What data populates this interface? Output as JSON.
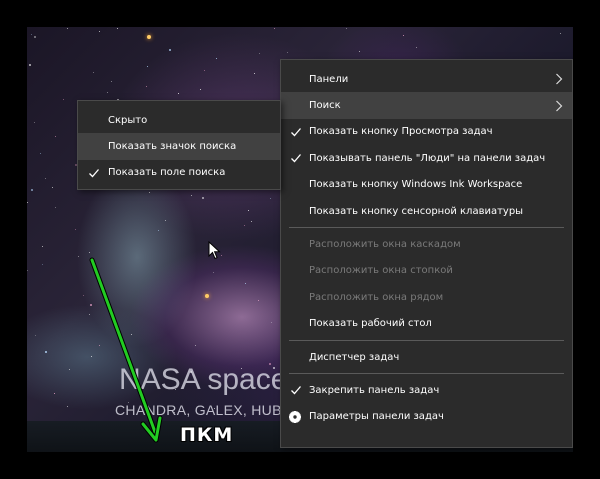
{
  "wallpaper": {
    "title": "NASA space",
    "subtitle": "CHANDRA, GALEX, HUB"
  },
  "annotation": {
    "label": "ПКМ",
    "arrow_color": "#22cc22"
  },
  "context_menu": {
    "groups": [
      [
        {
          "label": "Панели",
          "submenu": true,
          "checked": false,
          "disabled": false,
          "highlighted": false
        },
        {
          "label": "Поиск",
          "submenu": true,
          "checked": false,
          "disabled": false,
          "highlighted": true
        },
        {
          "label": "Показать кнопку Просмотра задач",
          "submenu": false,
          "checked": true,
          "disabled": false,
          "highlighted": false
        },
        {
          "label": "Показывать панель \"Люди\" на панели задач",
          "submenu": false,
          "checked": true,
          "disabled": false,
          "highlighted": false
        },
        {
          "label": "Показать кнопку Windows Ink Workspace",
          "submenu": false,
          "checked": false,
          "disabled": false,
          "highlighted": false
        },
        {
          "label": "Показать кнопку сенсорной клавиатуры",
          "submenu": false,
          "checked": false,
          "disabled": false,
          "highlighted": false
        }
      ],
      [
        {
          "label": "Расположить окна каскадом",
          "submenu": false,
          "checked": false,
          "disabled": true,
          "highlighted": false
        },
        {
          "label": "Расположить окна стопкой",
          "submenu": false,
          "checked": false,
          "disabled": true,
          "highlighted": false
        },
        {
          "label": "Расположить окна рядом",
          "submenu": false,
          "checked": false,
          "disabled": true,
          "highlighted": false
        },
        {
          "label": "Показать рабочий стол",
          "submenu": false,
          "checked": false,
          "disabled": false,
          "highlighted": false
        }
      ],
      [
        {
          "label": "Диспетчер задач",
          "submenu": false,
          "checked": false,
          "disabled": false,
          "highlighted": false
        }
      ],
      [
        {
          "label": "Закрепить панель задач",
          "submenu": false,
          "checked": true,
          "disabled": false,
          "highlighted": false
        },
        {
          "label": "Параметры панели задач",
          "submenu": false,
          "checked": false,
          "disabled": false,
          "highlighted": false,
          "icon": "gear-icon"
        }
      ]
    ]
  },
  "search_submenu": {
    "items": [
      {
        "label": "Скрыто",
        "checked": false,
        "highlighted": false
      },
      {
        "label": "Показать значок поиска",
        "checked": false,
        "highlighted": true
      },
      {
        "label": "Показать поле поиска",
        "checked": true,
        "highlighted": false
      }
    ]
  },
  "colors": {
    "menu_bg": "#2b2b2b",
    "menu_highlight": "#414141",
    "menu_disabled_text": "#7a7a7a"
  }
}
